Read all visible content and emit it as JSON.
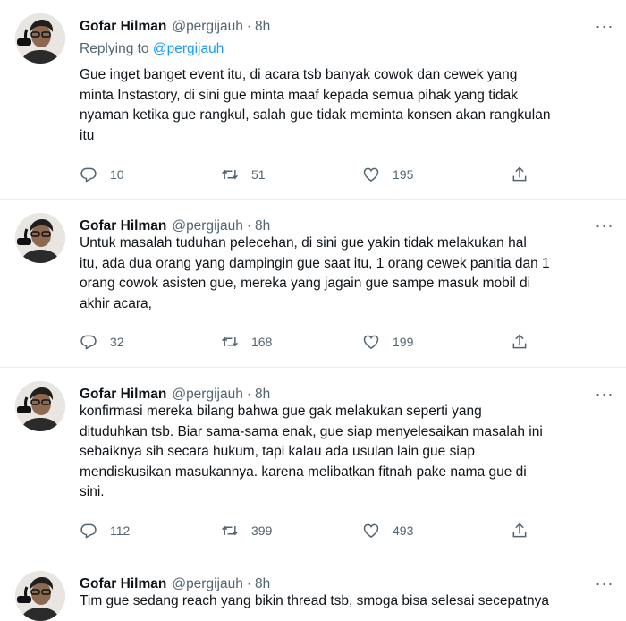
{
  "tweets": [
    {
      "name": "Gofar Hilman",
      "handle": "@pergijauh",
      "sep": "·",
      "time": "8h",
      "replying_prefix": "Replying to ",
      "replying_to": "@pergijauh",
      "text": "Gue inget banget event itu, di acara tsb banyak cowok dan cewek yang\nminta Instastory, di sini gue minta maaf kepada semua pihak yang tidak\nnyaman ketika gue rangkul, salah gue tidak meminta konsen akan rangkulan\nitu",
      "replies": "10",
      "retweets": "51",
      "likes": "195"
    },
    {
      "name": "Gofar Hilman",
      "handle": "@pergijauh",
      "sep": "·",
      "time": "8h",
      "text": "Untuk masalah tuduhan pelecehan, di sini gue yakin tidak melakukan hal\nitu, ada dua orang yang dampingin gue saat itu, 1 orang cewek panitia dan 1\norang cowok asisten gue,  mereka yang jagain gue sampe masuk mobil di\nakhir acara,",
      "replies": "32",
      "retweets": "168",
      "likes": "199"
    },
    {
      "name": "Gofar Hilman",
      "handle": "@pergijauh",
      "sep": "·",
      "time": "8h",
      "text": "konfirmasi mereka bilang bahwa gue gak melakukan seperti yang\ndituduhkan tsb. Biar sama-sama enak, gue siap menyelesaikan masalah ini\nsebaiknya sih secara hukum, tapi kalau ada usulan lain gue siap\nmendiskusikan masukannya. karena melibatkan fitnah pake nama gue di\nsini.",
      "replies": "112",
      "retweets": "399",
      "likes": "493"
    },
    {
      "name": "Gofar Hilman",
      "handle": "@pergijauh",
      "sep": "·",
      "time": "8h",
      "text": "Tim gue sedang reach yang bikin thread tsb, smoga bisa selesai secepatnya"
    }
  ],
  "icons": {
    "reply": "reply-icon",
    "retweet": "retweet-icon",
    "like": "heart-icon",
    "share": "share-icon",
    "more": "more-icon"
  },
  "colors": {
    "link": "#1d9bf0",
    "muted": "#536471",
    "text": "#0f1419"
  }
}
